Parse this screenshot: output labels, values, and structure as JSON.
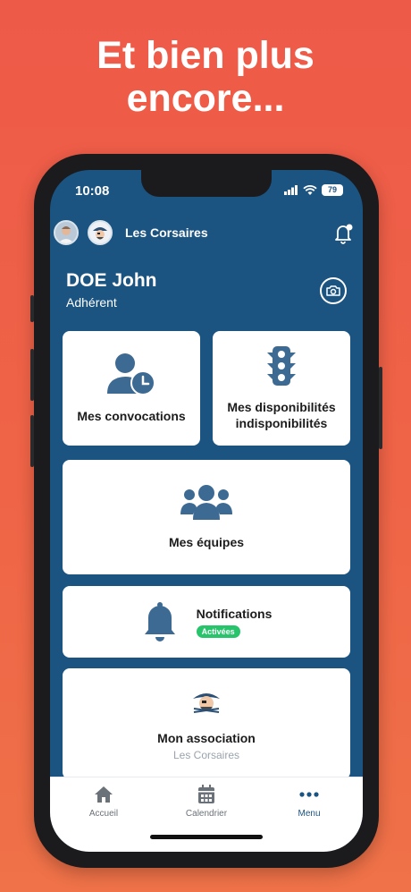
{
  "headline": {
    "line1": "Et bien plus",
    "line2": "encore..."
  },
  "status_bar": {
    "time": "10:08",
    "battery": "79"
  },
  "top_bar": {
    "club_name": "Les Corsaires"
  },
  "profile": {
    "name": "DOE John",
    "role": "Adhérent"
  },
  "cards": {
    "convocations": "Mes convocations",
    "disponibilites_line1": "Mes disponibilités",
    "disponibilites_line2": "indisponibilités",
    "equipes": "Mes équipes",
    "notifications": "Notifications",
    "notifications_badge": "Activées",
    "association": "Mon association",
    "association_sub": "Les Corsaires"
  },
  "tabs": {
    "home": "Accueil",
    "calendar": "Calendrier",
    "menu": "Menu"
  },
  "colors": {
    "background": "#ee5a48",
    "screen": "#1b5381",
    "icon": "#3d6a93",
    "badge": "#27c46b",
    "tab_active": "#1b5381",
    "tab_inactive": "#6b7178"
  }
}
